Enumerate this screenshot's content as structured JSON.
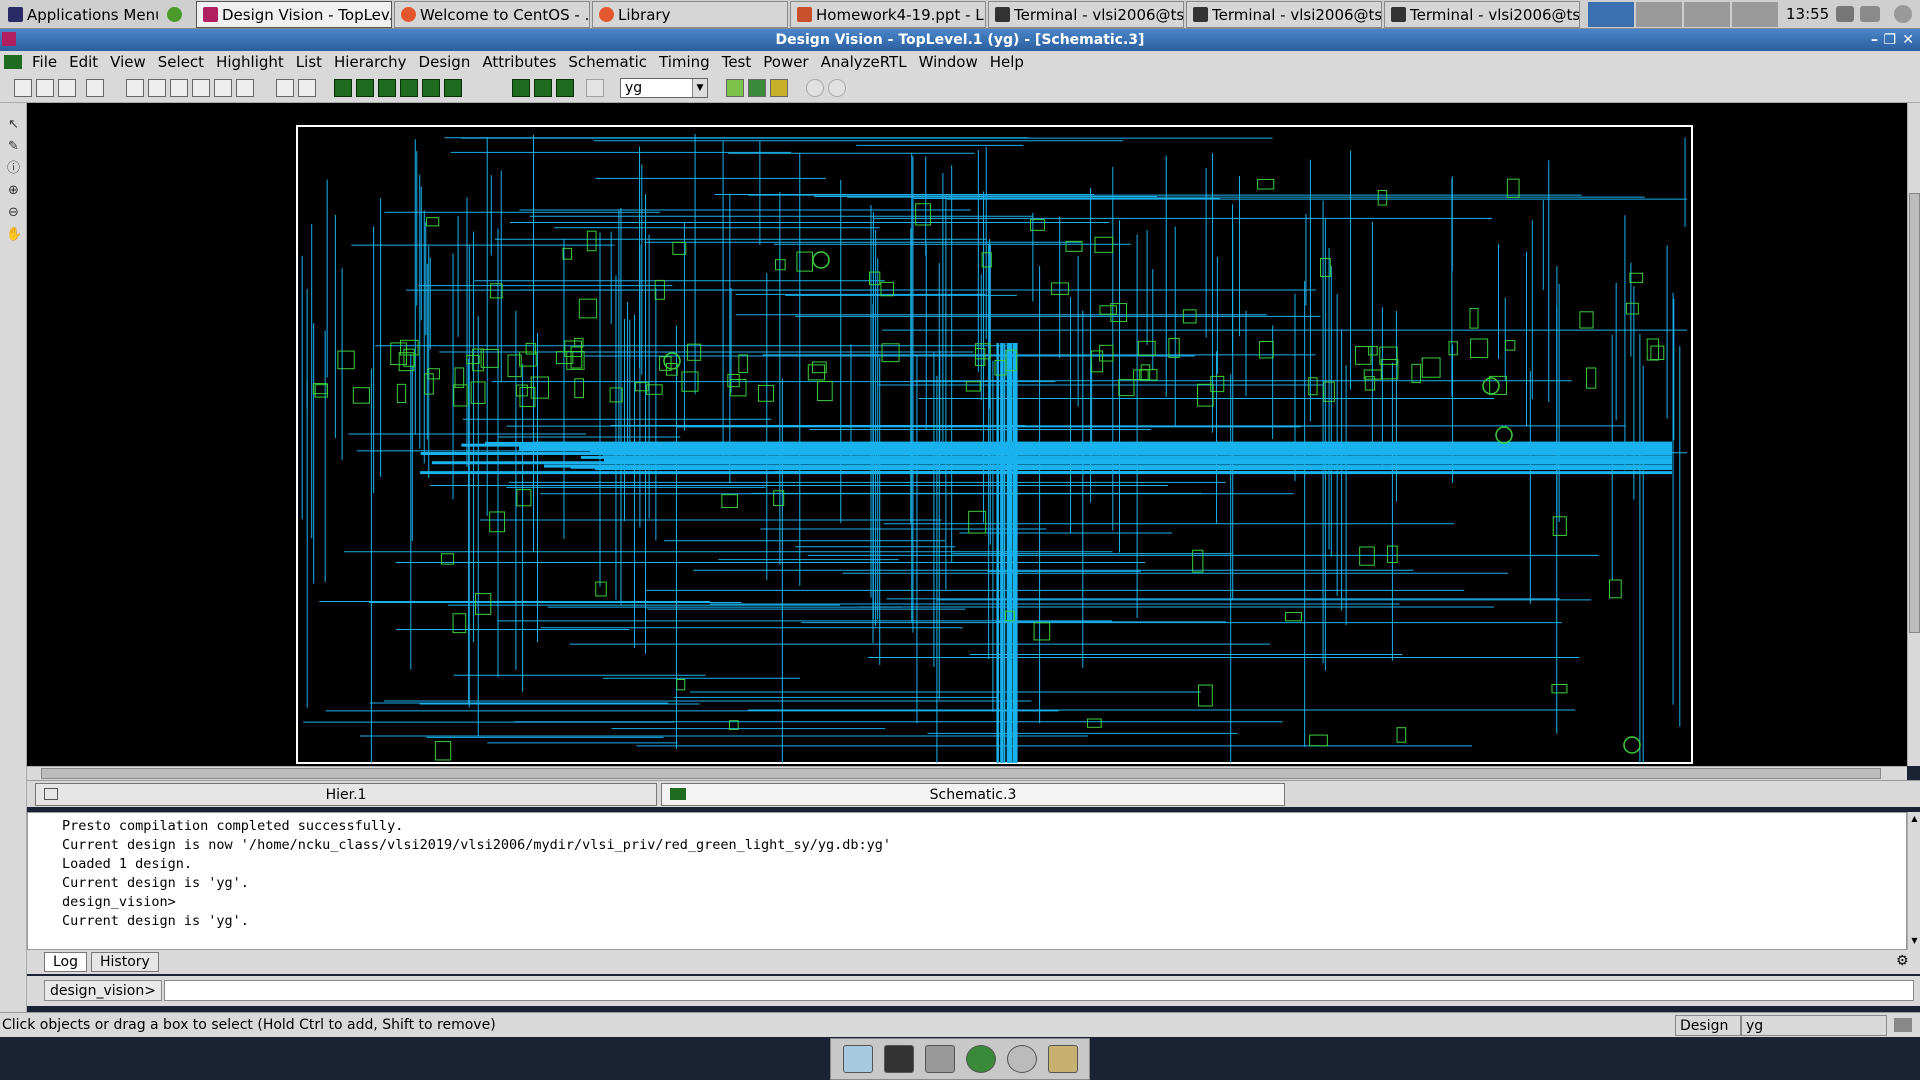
{
  "taskbar": {
    "apps_menu": "Applications Menu",
    "tasks": [
      {
        "label": "Design Vision - TopLev...",
        "icon": "design-vision-icon",
        "active": true
      },
      {
        "label": "Welcome to CentOS - ...",
        "icon": "firefox-icon"
      },
      {
        "label": "Library",
        "icon": "firefox-icon"
      },
      {
        "label": "Homework4-19.ppt - Li...",
        "icon": "impress-icon"
      },
      {
        "label": "Terminal - vlsi2006@tsr...",
        "icon": "terminal-icon"
      },
      {
        "label": "Terminal - vlsi2006@tsr...",
        "icon": "terminal-icon"
      },
      {
        "label": "Terminal - vlsi2006@tsr...",
        "icon": "terminal-icon"
      }
    ],
    "clock": "13:55"
  },
  "window": {
    "title": "Design Vision - TopLevel.1 (yg) - [Schematic.3]"
  },
  "menus": [
    "File",
    "Edit",
    "View",
    "Select",
    "Highlight",
    "List",
    "Hierarchy",
    "Design",
    "Attributes",
    "Schematic",
    "Timing",
    "Test",
    "Power",
    "AnalyzeRTL",
    "Window",
    "Help"
  ],
  "toolbar": {
    "design_select": "yg"
  },
  "tabs": {
    "hier": "Hier.1",
    "schematic": "Schematic.3"
  },
  "console": {
    "lines": [
      "Presto compilation completed successfully.",
      "Current design is now '/home/ncku_class/vlsi2019/vlsi2006/mydir/vlsi_priv/red_green_light_sy/yg.db:yg'",
      "Loaded 1 design.",
      "Current design is 'yg'.",
      "design_vision>",
      "Current design is 'yg'."
    ],
    "tab_log": "Log",
    "tab_history": "History",
    "prompt": "design_vision>",
    "input_value": ""
  },
  "status": {
    "message": "Click objects or drag a box to select (Hold Ctrl to add, Shift to remove)",
    "design_label": "Design",
    "design_value": "yg"
  },
  "colors": {
    "wire": "#1ab2ee",
    "cell": "#3ccf3c",
    "background": "#000000"
  }
}
